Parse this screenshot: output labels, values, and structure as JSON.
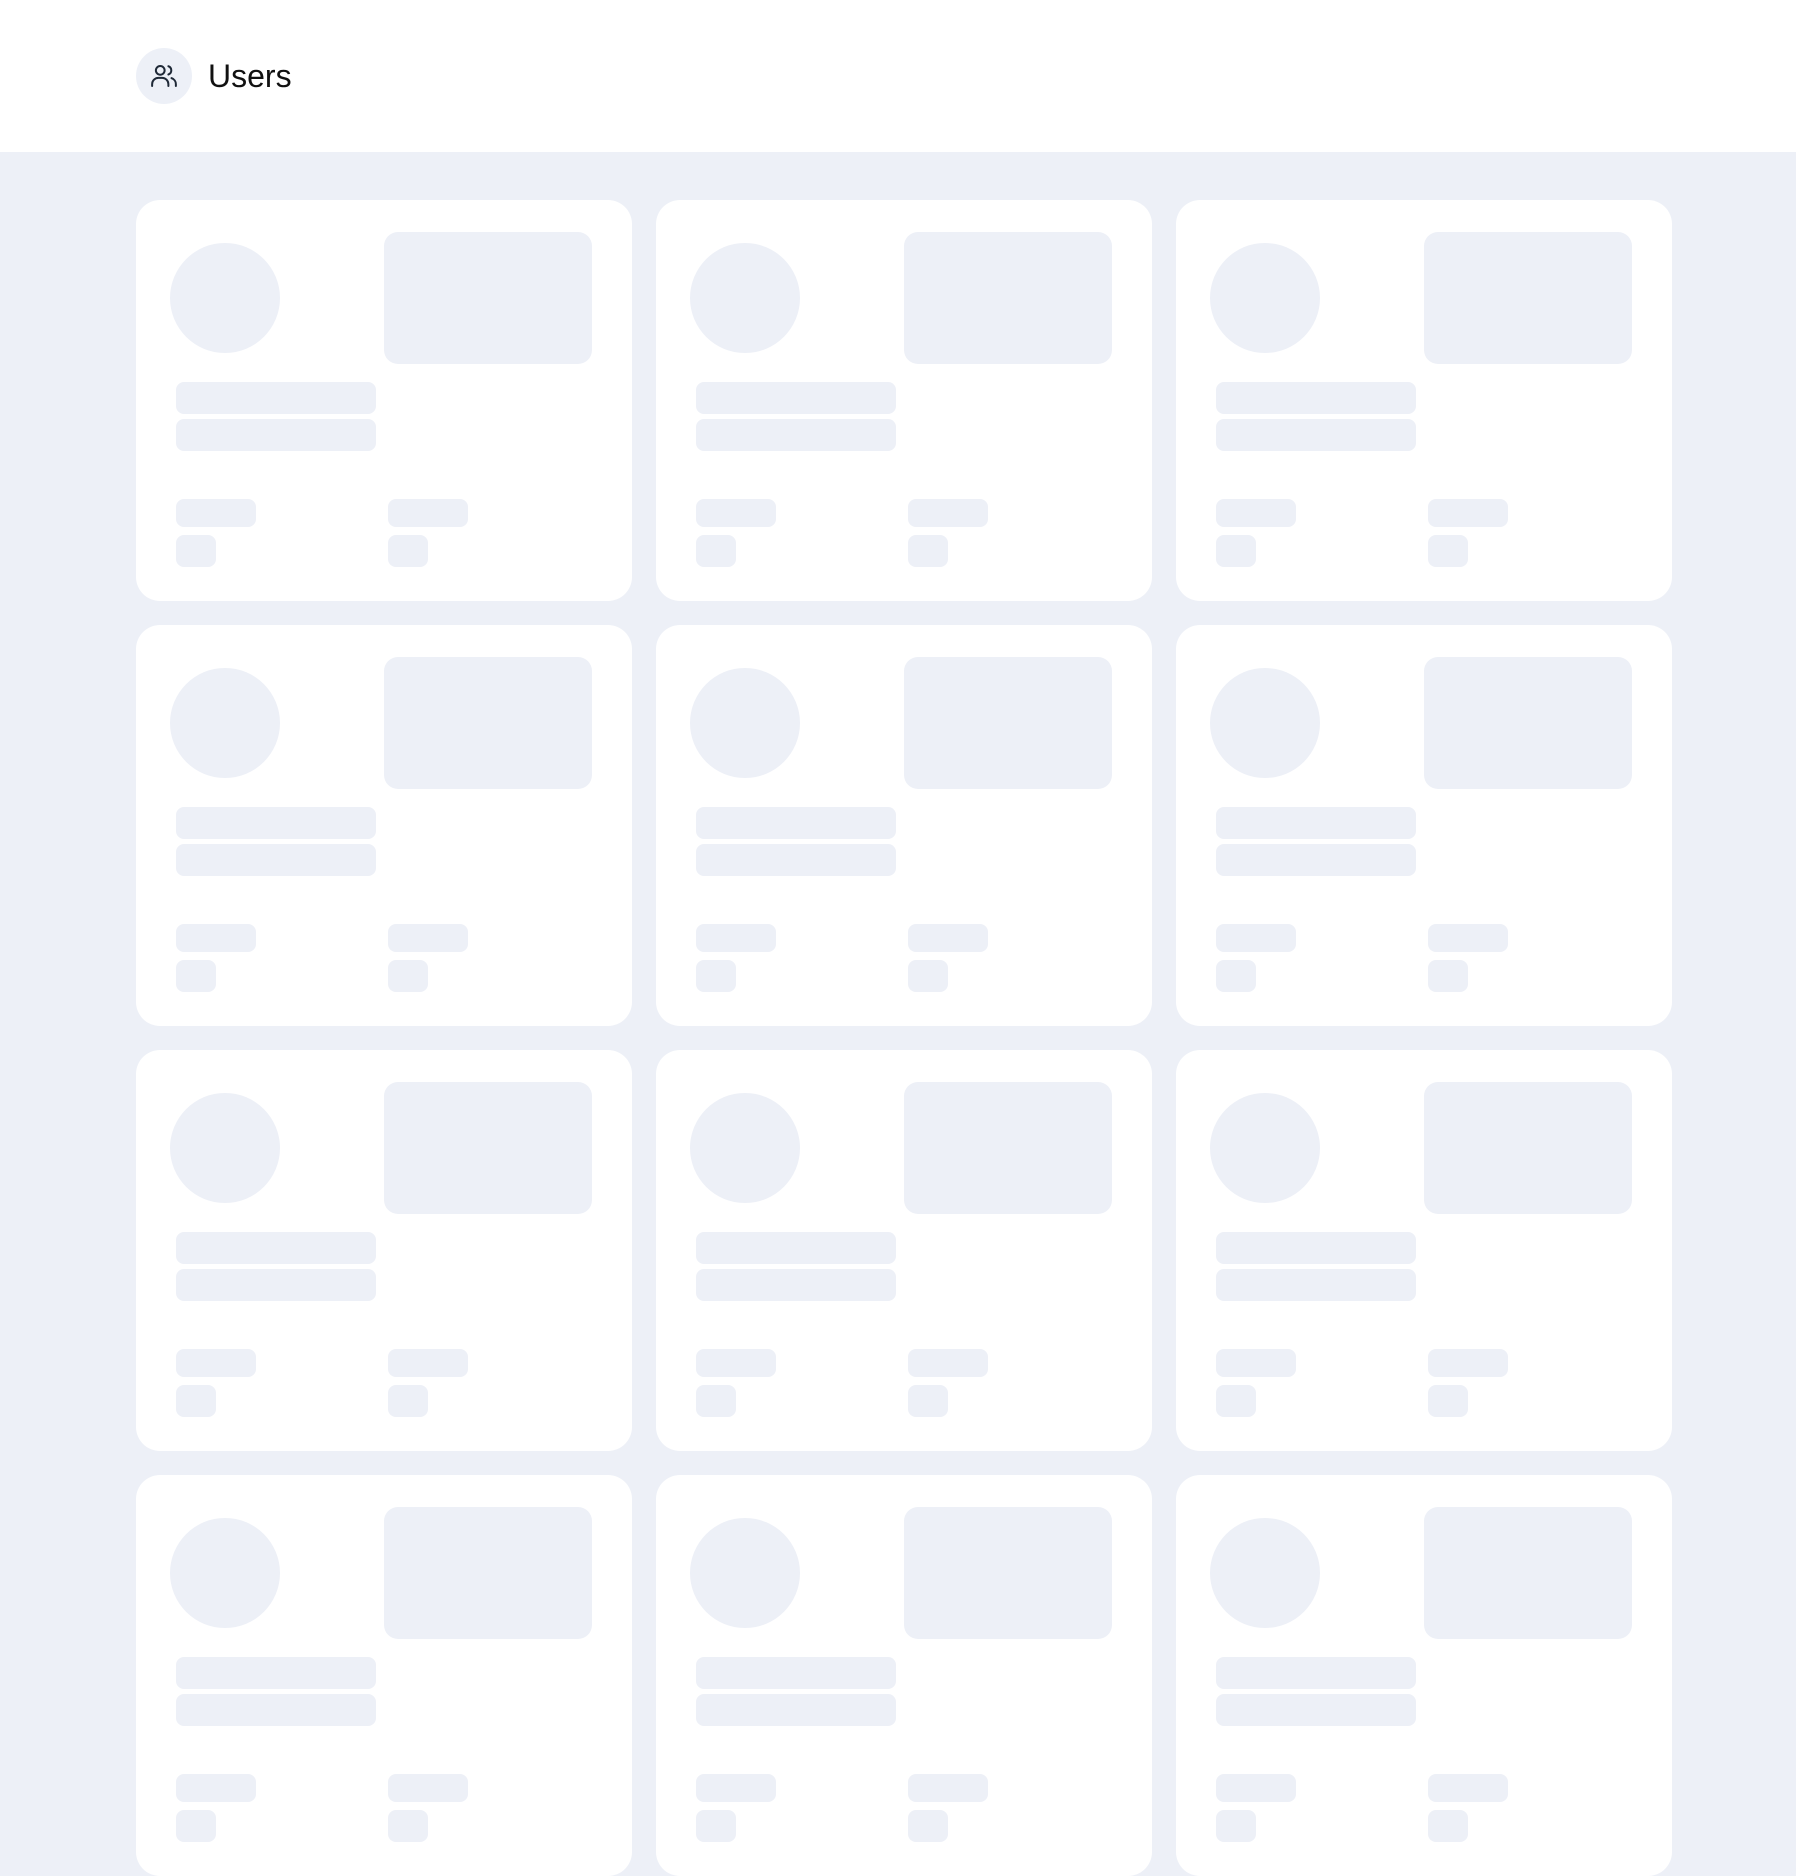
{
  "header": {
    "title": "Users",
    "icon": "users-icon"
  },
  "colors": {
    "background": "#edf0f7",
    "surface": "#ffffff",
    "skeleton": "#edf0f7",
    "text": "#111111"
  },
  "grid": {
    "state": "loading",
    "columns": 3,
    "visible_cards": 12
  }
}
